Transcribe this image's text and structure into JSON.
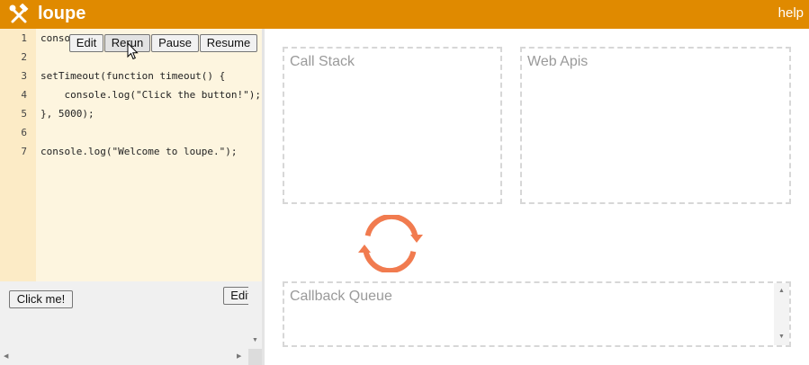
{
  "header": {
    "title": "loupe",
    "help_label": "help",
    "background_color": "#e08a00"
  },
  "editor": {
    "line_numbers": [
      "1",
      "2",
      "3",
      "4",
      "5",
      "6",
      "7"
    ],
    "lines": [
      "conso",
      "",
      "setTimeout(function timeout() {",
      "    console.log(\"Click the button!\");",
      "}, 5000);",
      "",
      "console.log(\"Welcome to loupe.\");"
    ],
    "buttons": {
      "edit": "Edit",
      "rerun": "Rerun",
      "pause": "Pause",
      "resume": "Resume"
    }
  },
  "html_panel": {
    "click_me_label": "Click me!",
    "edit_label": "Edit"
  },
  "visualizer": {
    "call_stack_label": "Call Stack",
    "web_apis_label": "Web Apis",
    "callback_queue_label": "Callback Queue",
    "event_loop_color": "#f17b4f"
  }
}
